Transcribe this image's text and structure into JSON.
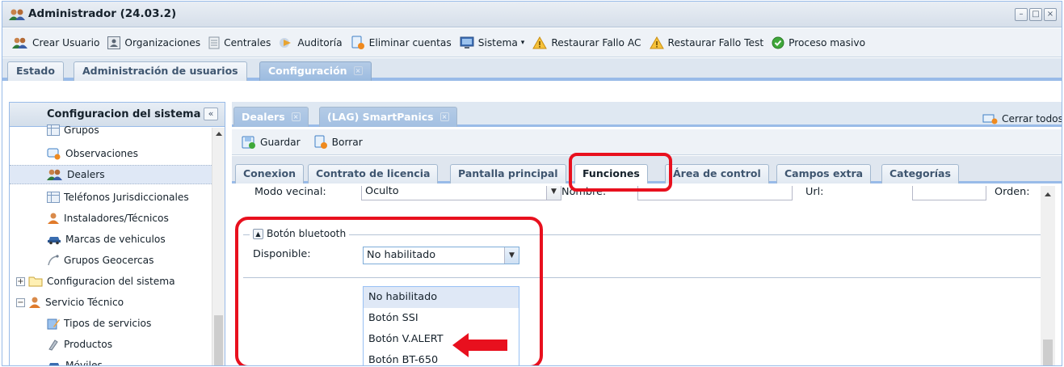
{
  "window": {
    "title": "Administrador (24.03.2)",
    "controls": [
      "–",
      "□",
      "×"
    ]
  },
  "toolbar": {
    "items": [
      {
        "label": "Crear Usuario",
        "icon": "users-icon"
      },
      {
        "label": "Organizaciones",
        "icon": "organization-icon"
      },
      {
        "label": "Centrales",
        "icon": "server-icon"
      },
      {
        "label": "Auditoría",
        "icon": "audit-icon"
      },
      {
        "label": "Eliminar cuentas",
        "icon": "document-delete-icon"
      },
      {
        "label": "Sistema",
        "icon": "monitor-icon",
        "caret": "▾"
      },
      {
        "label": "Restaurar Fallo AC",
        "icon": "warning-icon"
      },
      {
        "label": "Restaurar Fallo Test",
        "icon": "warning-icon"
      },
      {
        "label": "Proceso masivo",
        "icon": "check-circle-icon"
      }
    ]
  },
  "main_tabs": [
    {
      "label": "Estado"
    },
    {
      "label": "Administración de usuarios"
    },
    {
      "label": "Configuración",
      "active": true,
      "close": "×"
    }
  ],
  "sidebar": {
    "title": "Configuracion del sistema",
    "collapse": "«",
    "items": [
      {
        "label": "Grupos",
        "icon": "table-icon"
      },
      {
        "label": "Observaciones",
        "icon": "observations-icon"
      },
      {
        "label": "Dealers",
        "icon": "users-icon",
        "selected": true
      },
      {
        "label": "Teléfonos Jurisdiccionales",
        "icon": "table-icon"
      },
      {
        "label": "Instaladores/Técnicos",
        "icon": "user-icon"
      },
      {
        "label": "Marcas de vehiculos",
        "icon": "car-icon"
      },
      {
        "label": "Grupos Geocercas",
        "icon": "geofence-icon"
      },
      {
        "label": "Configuracion del sistema",
        "icon": "folder-icon",
        "expander": "+"
      },
      {
        "label": "Servicio Técnico",
        "icon": "user-icon",
        "expander": "−"
      },
      {
        "label": "Tipos de servicios",
        "icon": "pencil-icon"
      },
      {
        "label": "Productos",
        "icon": "product-icon"
      },
      {
        "label": "Móviles",
        "icon": "car-icon"
      }
    ]
  },
  "sub_tabs": [
    {
      "label": "Dealers",
      "close": "×"
    },
    {
      "label": "(LAG) SmartPanics",
      "close": "×"
    }
  ],
  "close_all": "Cerrar todos",
  "actions": {
    "save": "Guardar",
    "delete": "Borrar"
  },
  "form_tabs": [
    {
      "label": "Conexion"
    },
    {
      "label": "Contrato de licencia"
    },
    {
      "label": "Pantalla principal"
    },
    {
      "label": "Funciones",
      "active": true
    },
    {
      "label": "Área de control"
    },
    {
      "label": "Campos extra"
    },
    {
      "label": "Categorías"
    }
  ],
  "form": {
    "modo_vecinal_label": "Modo vecinal:",
    "modo_vecinal_value": "Oculto",
    "nombre_label": "Nombre:",
    "nombre_value": "",
    "url_label": "Url:",
    "url_value": "",
    "orden_label": "Orden:",
    "orden_value": "",
    "fieldset_title": "Botón bluetooth",
    "disponible_label": "Disponible:",
    "disponible_value": "No habilitado",
    "dropdown_options": [
      "No habilitado",
      "Botón SSI",
      "Botón V.ALERT",
      "Botón BT-650"
    ]
  },
  "colors": {
    "annotation": "#e8101e",
    "accent": "#99bbe8",
    "active_tab": "#9bbbe0"
  }
}
